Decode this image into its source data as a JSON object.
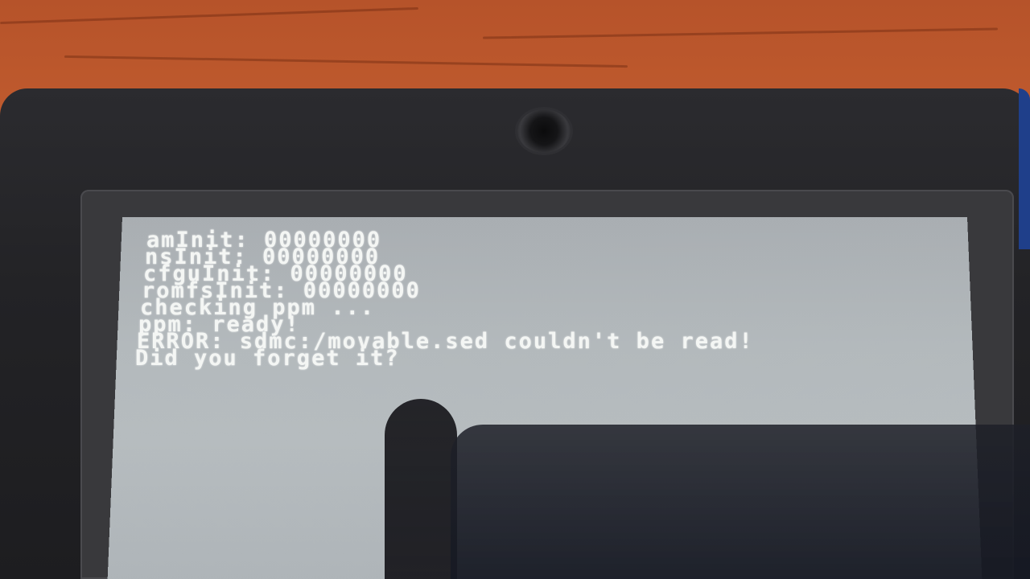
{
  "console": {
    "lines": [
      "amInit: 00000000",
      "nsInit: 00000000",
      "cfguInit: 00000000",
      "romfsInit: 00000000",
      "checking ppm ...",
      "ppm: ready!",
      "ERROR: sdmc:/movable.sed couldn't be read!",
      "Did you forget it?"
    ]
  },
  "colors": {
    "console_text": "#f4f6f4",
    "screen_background": "#b3b9bc",
    "device_body": "#232326",
    "table_wood": "#b6532a"
  }
}
